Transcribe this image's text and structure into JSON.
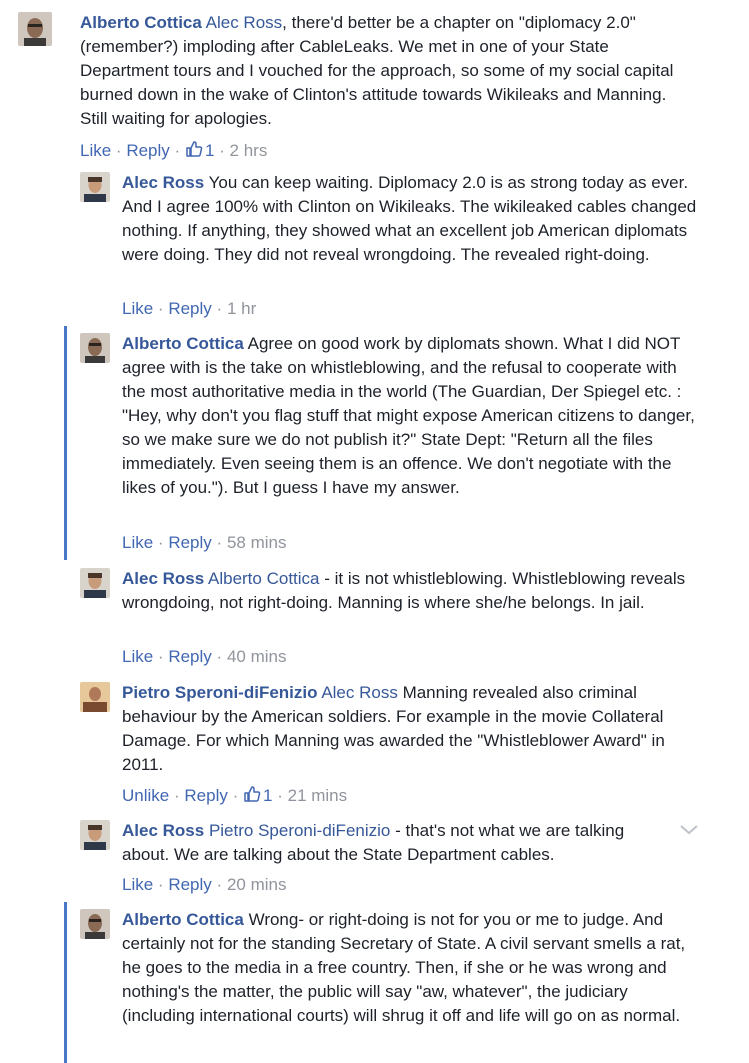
{
  "comments": [
    {
      "author": "Alberto Cottica",
      "mention": "Alec Ross",
      "body": ", there'd better be a chapter on \"diplomacy 2.0\" (remember?) imploding after CableLeaks. We met in one of your State Department tours and I vouched for the approach, so some of my social capital burned down in the wake of Clinton's attitude towards Wikileaks and Manning. Still waiting for apologies.",
      "actions": {
        "primary": "Like",
        "reply": "Reply",
        "likes": "1",
        "time": "2 hrs"
      }
    },
    {
      "author": "Alec Ross",
      "mention": "",
      "body": "You can keep waiting. Diplomacy 2.0 is as strong today as ever. And I agree 100% with Clinton on Wikileaks. The wikileaked cables changed nothing. If anything, they showed what an excellent job American diplomats were doing. They did not reveal wrongdoing. The revealed right-doing.",
      "actions": {
        "primary": "Like",
        "reply": "Reply",
        "time": "1 hr"
      }
    },
    {
      "author": "Alberto Cottica",
      "mention": "",
      "body": "Agree on good work by diplomats shown. What I did NOT agree with is the take on whistleblowing, and the refusal to cooperate with the most authoritative media in the world (The Guardian, Der Spiegel etc. : \"Hey, why don't you flag stuff that might expose American citizens to danger, so we make sure we do not publish it?\" State Dept: \"Return all the files immediately. Even seeing them is an offence. We don't negotiate with the likes of you.\"). But I guess I have my answer.",
      "actions": {
        "primary": "Like",
        "reply": "Reply",
        "time": "58 mins"
      }
    },
    {
      "author": "Alec Ross",
      "mention": "Alberto Cottica",
      "body": " - it is not whistleblowing. Whistleblowing reveals wrongdoing, not right-doing. Manning is where she/he belongs. In jail.",
      "actions": {
        "primary": "Like",
        "reply": "Reply",
        "time": "40 mins"
      }
    },
    {
      "author": "Pietro Speroni-diFenizio",
      "mention": "Alec Ross",
      "body": " Manning revealed also criminal behaviour by the American soldiers. For example in the movie Collateral Damage. For which Manning was awarded the \"Whistleblower Award\" in 2011.",
      "actions": {
        "primary": "Unlike",
        "reply": "Reply",
        "likes": "1",
        "time": "21 mins"
      }
    },
    {
      "author": "Alec Ross",
      "mention": "Pietro Speroni-diFenizio",
      "body": " - that's not what we are talking about. We are talking about the State Department cables.",
      "actions": {
        "primary": "Like",
        "reply": "Reply",
        "time": "20 mins"
      }
    },
    {
      "author": "Alberto Cottica",
      "mention": "",
      "body": "Wrong- or right-doing is not for you or me to judge. And certainly not for the standing Secretary of State. A civil servant smells a rat, he goes to the media in a free country. Then, if she or he was wrong and nothing's the matter, the public will say \"aw, whatever\", the judiciary (including international courts) will shrug it off and life will go on as normal.",
      "actions": {}
    }
  ],
  "colors": {
    "link": "#365899",
    "action": "#4267b2",
    "meta": "#90949c",
    "thread_bar": "#4a76c7"
  },
  "icons": {
    "like": "thumbs-up-icon",
    "options": "chevron-down-icon"
  }
}
